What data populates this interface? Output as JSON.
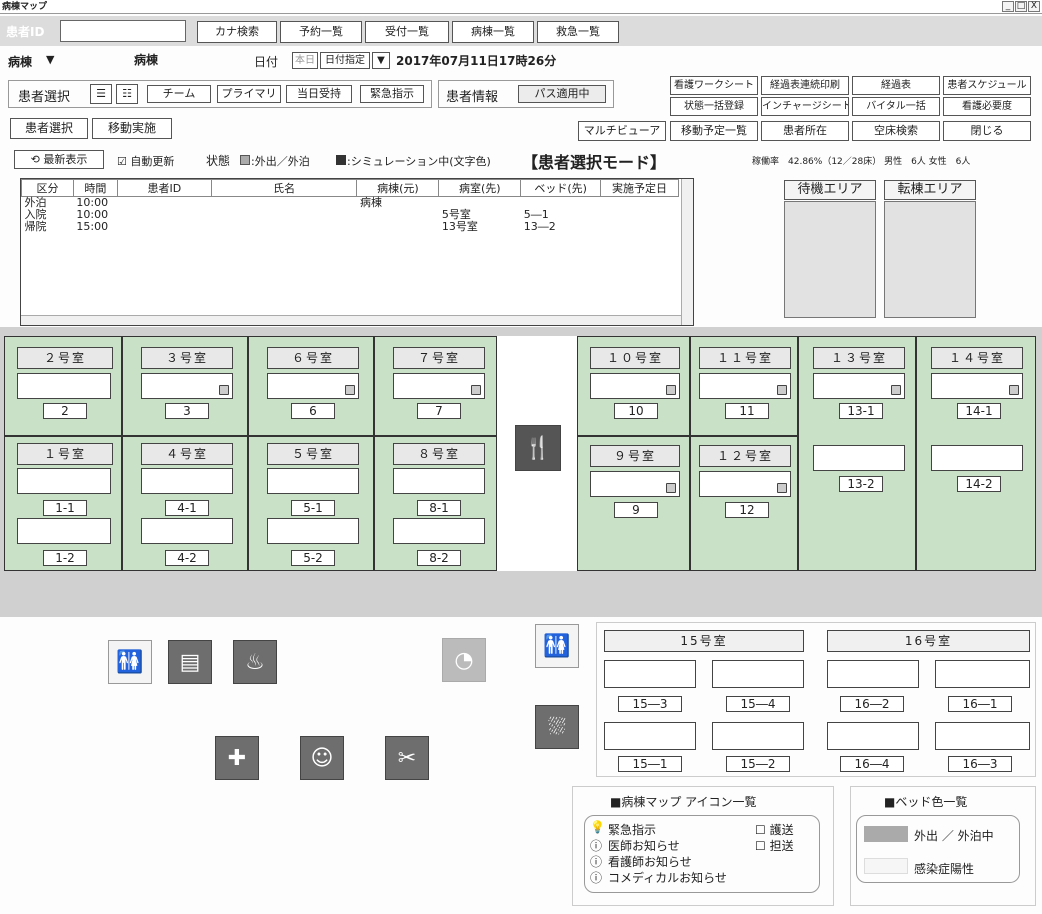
{
  "window": {
    "title": "病棟マップ",
    "min": "_",
    "max": "□",
    "close": "X"
  },
  "top": {
    "patient_id_label": "患者ID",
    "buttons": [
      "カナ検索",
      "予約一覧",
      "受付一覧",
      "病棟一覧",
      "救急一覧"
    ],
    "ward_label": "病棟",
    "ward_value": "病棟",
    "date_label": "日付",
    "today_label": "本日",
    "date_mode": "日付指定",
    "datetime": "2017年07月11日17時26分"
  },
  "select": {
    "label": "患者選択",
    "team": "チーム",
    "primary": "プライマリ",
    "sameday": "当日受持",
    "urgent": "緊急指示",
    "info_label": "患者情報",
    "path_status": "パス適用中"
  },
  "right_buttons": [
    [
      "看護ワークシート",
      "経過表連続印刷",
      "経過表",
      "患者スケジュール"
    ],
    [
      "状態一括登録",
      "インチャージシート",
      "バイタル一括",
      "看護必要度"
    ],
    [
      "移動予定一覧",
      "患者所在",
      "空床検索",
      "閉じる"
    ]
  ],
  "modes": {
    "select": "患者選択",
    "move": "移動実施",
    "multiviewer": "マルチビューア"
  },
  "status": {
    "refresh": "最新表示",
    "auto_refresh": "自動更新",
    "state_label": "状態",
    "legend1": ":外出／外泊",
    "legend2": ":シミュレーション中(文字色)",
    "mode_title": "【患者選択モード】",
    "occupancy": "稼働率　42.86%（12／28床） 男性　6人 女性　6人"
  },
  "table": {
    "headers": [
      "区分",
      "時間",
      "患者ID",
      "氏名",
      "病棟(元)",
      "病室(先)",
      "ベッド(先)",
      "実施予定日"
    ],
    "rows": [
      [
        "外泊",
        "10:00",
        "",
        "",
        "病棟",
        "",
        "",
        ""
      ],
      [
        "入院",
        "10:00",
        "",
        "",
        "",
        "5号室",
        "5―1",
        ""
      ],
      [
        "帰院",
        "15:00",
        "",
        "",
        "",
        "13号室",
        "13―2",
        ""
      ]
    ]
  },
  "areas": {
    "waiting": "待機エリア",
    "transfer": "転棟エリア"
  },
  "rooms_left": [
    {
      "title": "２号室",
      "beds": [
        "2"
      ]
    },
    {
      "title": "３号室",
      "beds": [
        "3"
      ]
    },
    {
      "title": "６号室",
      "beds": [
        "6"
      ]
    },
    {
      "title": "７号室",
      "beds": [
        "7"
      ]
    },
    {
      "title": "１号室",
      "beds": [
        "1-1",
        "1-2"
      ]
    },
    {
      "title": "４号室",
      "beds": [
        "4-1",
        "4-2"
      ]
    },
    {
      "title": "５号室",
      "beds": [
        "5-1",
        "5-2"
      ]
    },
    {
      "title": "８号室",
      "beds": [
        "8-1",
        "8-2"
      ]
    }
  ],
  "rooms_right": [
    {
      "title": "１０号室",
      "beds": [
        "10"
      ]
    },
    {
      "title": "１１号室",
      "beds": [
        "11"
      ]
    },
    {
      "title": "１３号室",
      "beds": [
        "13-1",
        "13-2"
      ]
    },
    {
      "title": "１４号室",
      "beds": [
        "14-1",
        "14-2"
      ]
    },
    {
      "title": "９号室",
      "beds": [
        "9"
      ]
    },
    {
      "title": "１２号室",
      "beds": [
        "12"
      ]
    }
  ],
  "rooms_bottom": [
    {
      "title": "15号室",
      "beds": [
        "15―3",
        "15―4",
        "15―1",
        "15―2"
      ]
    },
    {
      "title": "16号室",
      "beds": [
        "16―2",
        "16―1",
        "16―4",
        "16―3"
      ]
    }
  ],
  "icon_legend": {
    "title": "■病棟マップ アイコン一覧",
    "items": [
      "緊急指示",
      "医師お知らせ",
      "看護師お知らせ",
      "コメディカルお知らせ"
    ],
    "checks": [
      "護送",
      "担送"
    ]
  },
  "bed_color_legend": {
    "title": "■ベッド色一覧",
    "items": [
      "外出 ／ 外泊中",
      "感染症陽性"
    ]
  }
}
